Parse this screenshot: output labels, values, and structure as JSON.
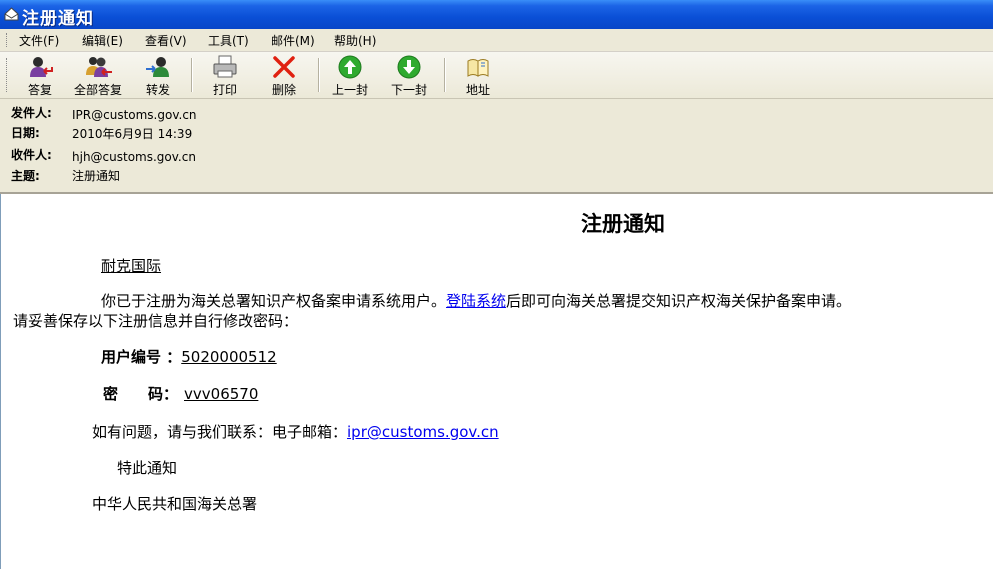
{
  "window": {
    "title": "注册通知"
  },
  "menu": {
    "items": [
      "文件(F)",
      "编辑(E)",
      "查看(V)",
      "工具(T)",
      "邮件(M)",
      "帮助(H)"
    ]
  },
  "toolbar": {
    "reply": "答复",
    "reply_all": "全部答复",
    "forward": "转发",
    "print": "打印",
    "delete": "删除",
    "previous": "上一封",
    "next": "下一封",
    "addresses": "地址"
  },
  "header": {
    "from_label": "发件人:",
    "from_value": "IPR@customs.gov.cn",
    "date_label": "日期:",
    "date_value": "2010年6月9日 14:39",
    "to_label": "收件人:",
    "to_value": "hjh@customs.gov.cn",
    "subject_label": "主题:",
    "subject_value": "注册通知"
  },
  "message": {
    "title": "注册通知",
    "recipient": "耐克国际",
    "para1_before": "你已于注册为海关总署知识产权备案申请系统用户。",
    "para1_link": "登陆系统",
    "para1_after": "后即可向海关总署提交知识产权海关保护备案申请。",
    "para1_line2": "请妥善保存以下注册信息并自行修改密码：",
    "user_id_label": "用户编号 ：",
    "user_id_value": "5020000512",
    "password_label": "密　　码：",
    "password_value": "vvv06570",
    "contact_prefix": "如有问题，请与我们联系：电子邮箱：",
    "contact_email": "ipr@customs.gov.cn",
    "notice": "特此通知",
    "signature": "中华人民共和国海关总署"
  },
  "colors": {
    "titlebar": "#0a4fd6",
    "chrome": "#ece9d8",
    "link": "#0000ee"
  }
}
